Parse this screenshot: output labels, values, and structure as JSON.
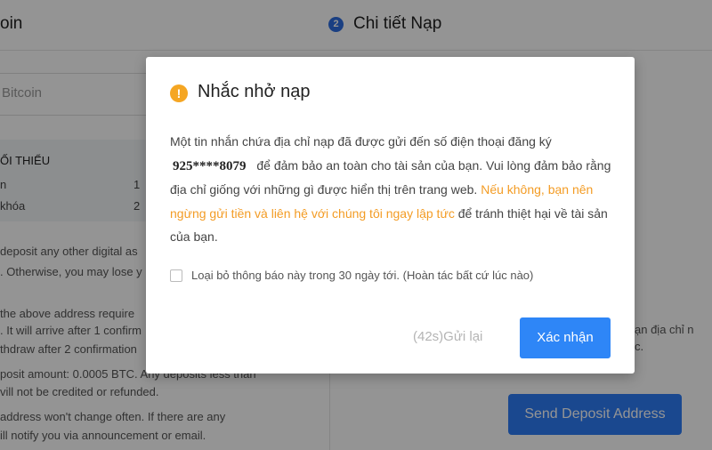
{
  "background": {
    "step1_label": "oin",
    "step2": {
      "number": "2",
      "label": "Chi tiết Nạp"
    },
    "step2_subtext": "...",
    "coin_field": {
      "value": "Bitcoin"
    },
    "min_table": {
      "header": "ỐI THIỂU",
      "rows": [
        {
          "label": "n",
          "value": "1"
        },
        {
          "label": "khóa",
          "value": "2"
        }
      ]
    },
    "notes": [
      "deposit any other digital as",
      ". Otherwise, you may lose y",
      "the above address require",
      ". It will arrive after 1 confirm",
      "thdraw after 2 confirmation",
      "posit amount: 0.0005 BTC. Any deposits less than",
      "vill not be credited or refunded.",
      "address won't change often. If there are any",
      "ill notify you via announcement or email."
    ],
    "right_notes": [
      "ạn địa chỉ n",
      "c."
    ],
    "send_button": "Send Deposit Address"
  },
  "modal": {
    "icon": "warning-icon",
    "title": "Nhắc nhở nạp",
    "body_part1": "Một tin nhắn chứa địa chỉ nạp đã được gửi đến số điện thoại đăng ký",
    "phone": "925****8079",
    "body_part2": "để đảm bảo an toàn cho tài sản của bạn. Vui lòng đảm bảo rằng địa chỉ giống với những gì được hiển thị trên trang web.",
    "warning": "Nếu không, bạn nên ngừng gửi tiền và liên hệ với chúng tôi ngay lập tức",
    "body_part3": "để tránh thiệt hại về tài sản của bạn.",
    "checkbox_label": "Loại bỏ thông báo này trong 30 ngày tới. (Hoàn tác bất cứ lúc nào)",
    "checkbox_checked": false,
    "resend_label": "(42s)Gửi lại",
    "confirm_label": "Xác nhận"
  },
  "colors": {
    "primary": "#2e86f7",
    "warning": "#f39c25",
    "overlay": "rgba(0,0,0,0.42)"
  }
}
